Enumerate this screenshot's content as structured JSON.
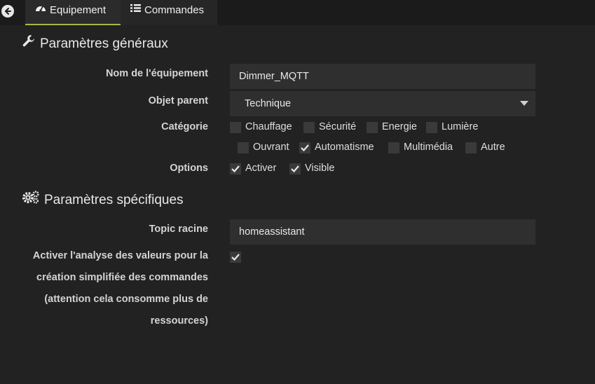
{
  "tabs": {
    "equipment": "Equipement",
    "commands": "Commandes"
  },
  "general": {
    "title": "Paramètres généraux",
    "name_label": "Nom de l'équipement",
    "name_value": "Dimmer_MQTT",
    "parent_label": "Objet parent",
    "parent_value": "Technique",
    "category_label": "Catégorie",
    "categories": [
      {
        "label": "Chauffage",
        "checked": false
      },
      {
        "label": "Sécurité",
        "checked": false
      },
      {
        "label": "Energie",
        "checked": false
      },
      {
        "label": "Lumière",
        "checked": false
      },
      {
        "label": "Ouvrant",
        "checked": false
      },
      {
        "label": "Automatisme",
        "checked": true
      },
      {
        "label": "Multimédia",
        "checked": false
      },
      {
        "label": "Autre",
        "checked": false
      }
    ],
    "options_label": "Options",
    "options": [
      {
        "label": "Activer",
        "checked": true
      },
      {
        "label": "Visible",
        "checked": true
      }
    ]
  },
  "specific": {
    "title": "Paramètres spécifiques",
    "topic_label": "Topic racine",
    "topic_value": "homeassistant",
    "analysis_label_lines": [
      "Activer l'analyse des valeurs pour la",
      "création simplifiée des commandes",
      "(attention cela consomme plus de",
      "ressources)"
    ],
    "analysis_checked": true
  },
  "icons": [
    "back-arrow-icon",
    "dashboard-icon",
    "list-icon",
    "wrench-icon",
    "gears-icon",
    "checkmark-icon",
    "caret-down-icon"
  ],
  "colors": {
    "accent": "#a3b94d",
    "background": "#222222",
    "input": "#2f2f2f"
  }
}
